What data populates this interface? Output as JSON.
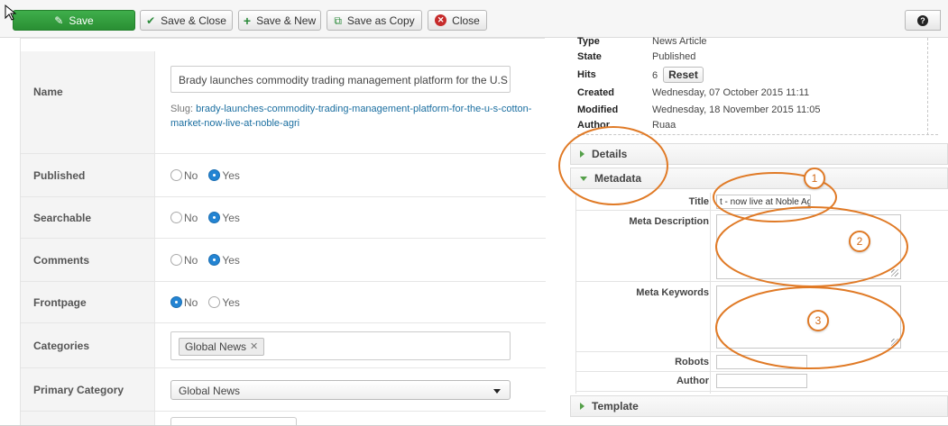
{
  "toolbar": {
    "save_label": "Save",
    "save_close_label": "Save & Close",
    "save_new_label": "Save & New",
    "save_copy_label": "Save as Copy",
    "close_label": "Close",
    "help_icon_glyph": "?"
  },
  "form": {
    "name_label": "Name",
    "name_value": "Brady launches commodity trading management platform for the U.S",
    "slug_prefix": "Slug:",
    "slug_value": "brady-launches-commodity-trading-management-platform-for-the-u-s-cotton-market-now-live-at-noble-agri",
    "published_label": "Published",
    "searchable_label": "Searchable",
    "comments_label": "Comments",
    "frontpage_label": "Frontpage",
    "no_label": "No",
    "yes_label": "Yes",
    "published_value": "Yes",
    "searchable_value": "Yes",
    "comments_value": "Yes",
    "frontpage_value": "No",
    "categories_label": "Categories",
    "category_tag": "Global News",
    "tag_remove_glyph": "✕",
    "primary_category_label": "Primary Category",
    "primary_category_value": "Global News"
  },
  "info": {
    "type_label": "Type",
    "type_value": "News Article",
    "state_label": "State",
    "state_value": "Published",
    "hits_label": "Hits",
    "hits_value": "6",
    "reset_label": "Reset",
    "created_label": "Created",
    "created_value": "Wednesday, 07 October 2015 11:11",
    "modified_label": "Modified",
    "modified_value": "Wednesday, 18 November 2015 11:05",
    "author_label": "Author",
    "author_value": "Ruaa"
  },
  "accordion": {
    "details_label": "Details",
    "metadata_label": "Metadata",
    "template_label": "Template"
  },
  "metadata": {
    "title_label": "Title",
    "title_value": "t - now live at Noble Agri",
    "description_label": "Meta Description",
    "description_value": "",
    "keywords_label": "Meta Keywords",
    "keywords_value": "",
    "robots_label": "Robots",
    "robots_value": "",
    "author_label": "Author",
    "author_value": ""
  },
  "annotations": {
    "badge_1": "1",
    "badge_2": "2",
    "badge_3": "3",
    "accent_color": "#e07a26"
  }
}
